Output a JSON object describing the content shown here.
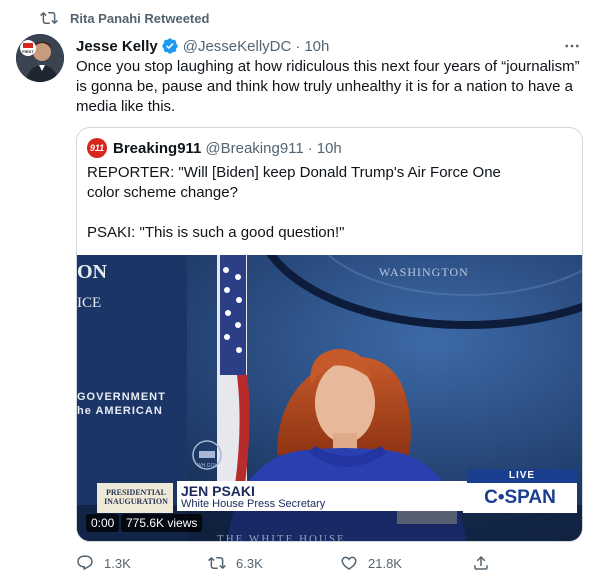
{
  "retweet": {
    "icon": "retweet-icon",
    "text": "Rita Panahi Retweeted"
  },
  "tweet": {
    "author_name": "Jesse Kelly",
    "handle": "@JesseKellyDC",
    "separator": "·",
    "time": "10h",
    "text": "Once you stop laughing at how ridiculous this next four years of “journalism” is gonna be, pause and think how truly unhealthy it is for a nation to have a media like this.",
    "avatar_logo": "FIRST",
    "more_icon": "more-icon"
  },
  "quote": {
    "avatar_text": "911",
    "author_name": "Breaking911",
    "handle": "@Breaking911",
    "separator": "·",
    "time": "10h",
    "line1": "REPORTER: \"Will [Biden] keep Donald Trump's Air Force One color scheme change?",
    "line2": "PSAKI: \"This is such a good question!\""
  },
  "video": {
    "wall_left_top": "ON",
    "wall_left_mid": "ICE",
    "wall_right": "WASHINGTON",
    "wall_gov1": "GOVERNMENT",
    "wall_gov2": "he AMERICAN",
    "wall_bottom": "THE WHITE HOUSE",
    "seal_text": "WH.GOV",
    "inauguration": "PRESIDENTIAL INAUGURATION",
    "speaker_name": "JEN PSAKI",
    "speaker_title": "White House Press Secretary",
    "live_label": "LIVE",
    "network": "C•SPAN",
    "elapsed": "0:00",
    "views": "775.6K views"
  },
  "actions": {
    "reply_count": "1.3K",
    "retweet_count": "6.3K",
    "like_count": "21.8K"
  },
  "colors": {
    "accent": "#1d9bf0",
    "muted": "#536471",
    "border": "#cfd9de",
    "cspan_blue": "#1b3f8f",
    "blazer": "#2a3fb0"
  }
}
